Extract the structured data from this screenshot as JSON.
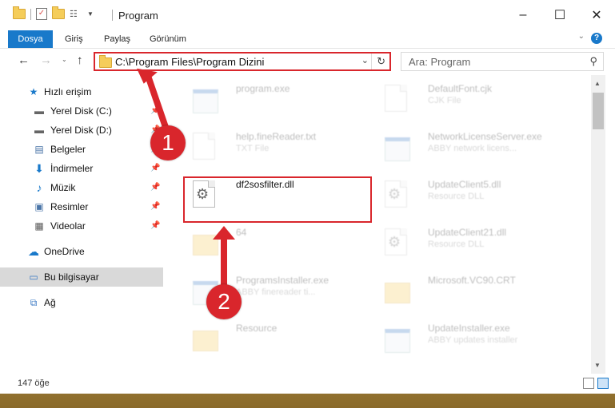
{
  "window": {
    "title": "Program"
  },
  "ribbon": {
    "tabs": [
      "Dosya",
      "Giriş",
      "Paylaş",
      "Görünüm"
    ]
  },
  "navigation": {
    "address": "C:\\Program Files\\Program Dizini",
    "search_placeholder": "Ara: Program"
  },
  "sidebar": {
    "items": [
      {
        "label": "Hızlı erişim",
        "icon": "star-icon"
      },
      {
        "label": "Yerel Disk (C:)",
        "icon": "drive-icon",
        "pinned": true
      },
      {
        "label": "Yerel Disk (D:)",
        "icon": "drive-icon",
        "pinned": true
      },
      {
        "label": "Belgeler",
        "icon": "documents-icon",
        "pinned": true
      },
      {
        "label": "İndirmeler",
        "icon": "download-icon",
        "pinned": true
      },
      {
        "label": "Müzik",
        "icon": "music-icon",
        "pinned": true
      },
      {
        "label": "Resimler",
        "icon": "pictures-icon",
        "pinned": true
      },
      {
        "label": "Videolar",
        "icon": "videos-icon",
        "pinned": true
      },
      {
        "label": "OneDrive",
        "icon": "cloud-icon"
      },
      {
        "label": "Bu bilgisayar",
        "icon": "computer-icon",
        "selected": true
      },
      {
        "label": "Ağ",
        "icon": "network-icon"
      }
    ]
  },
  "files": [
    {
      "name": "program.exe",
      "desc": "",
      "type": "exe",
      "faded": true
    },
    {
      "name": "DefaultFont.cjk",
      "desc": "CJK File",
      "type": "doc",
      "faded": true
    },
    {
      "name": "help.fineReader.txt",
      "desc": "TXT File",
      "type": "doc",
      "faded": true
    },
    {
      "name": "NetworkLicenseServer.exe",
      "desc": "ABBY network licens...",
      "type": "exe",
      "faded": true
    },
    {
      "name": "df2sosfilter.dll",
      "desc": "",
      "type": "dll",
      "faded": false
    },
    {
      "name": "UpdateClient5.dll",
      "desc": "Resource DLL",
      "type": "dll",
      "faded": true
    },
    {
      "name": "64",
      "desc": "",
      "type": "folder",
      "faded": true
    },
    {
      "name": "UpdateClient21.dll",
      "desc": "Resource DLL",
      "type": "dll",
      "faded": true
    },
    {
      "name": "ProgramsInstaller.exe",
      "desc": "ABBY finereader ti...",
      "type": "exe",
      "faded": true
    },
    {
      "name": "Microsoft.VC90.CRT",
      "desc": "",
      "type": "folder",
      "faded": true
    },
    {
      "name": "Resource",
      "desc": "",
      "type": "folder",
      "faded": true
    },
    {
      "name": "UpdateInstaller.exe",
      "desc": "ABBY updates installer",
      "type": "exe",
      "faded": true
    }
  ],
  "status": {
    "count": "147 öğe"
  },
  "annotations": {
    "step1": "1",
    "step2": "2",
    "color": "#d9262c"
  }
}
